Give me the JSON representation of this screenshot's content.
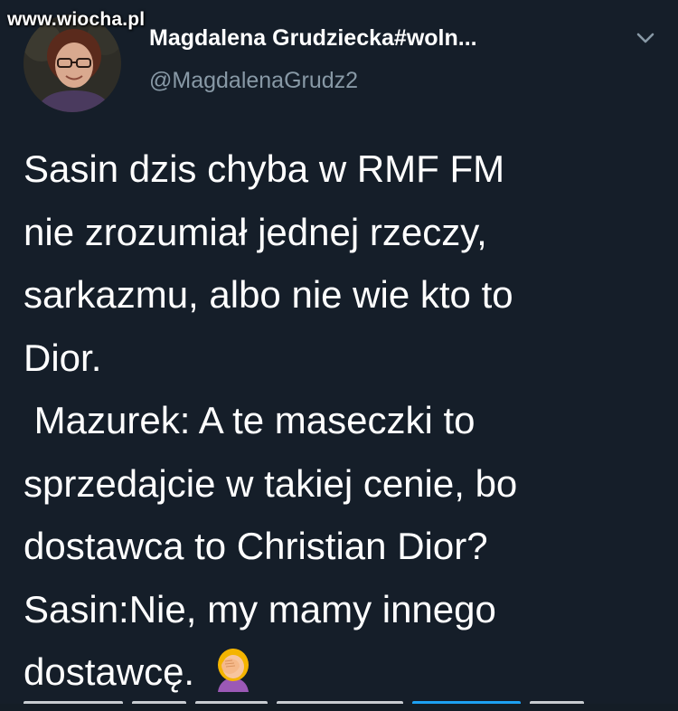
{
  "watermark": "www.wiocha.pl",
  "author": {
    "display_name": "Magdalena Grudziecka#woln...",
    "handle": "@MagdalenaGrudz2"
  },
  "tweet": {
    "lines": [
      "Sasin dzis chyba w RMF FM",
      "nie zrozumiał jednej rzeczy,",
      "sarkazmu, albo nie wie kto to",
      "Dior.",
      " Mazurek: A te maseczki to",
      "sprzedajcie w takiej cenie, bo",
      "dostawca to Christian Dior?",
      "Sasin:Nie, my mamy innego",
      "dostawcę."
    ],
    "emoji": "facepalm-emoji"
  },
  "colors": {
    "background": "#151e29",
    "text": "#ffffff",
    "handle": "#8899a6",
    "link": "#1da1f2"
  }
}
